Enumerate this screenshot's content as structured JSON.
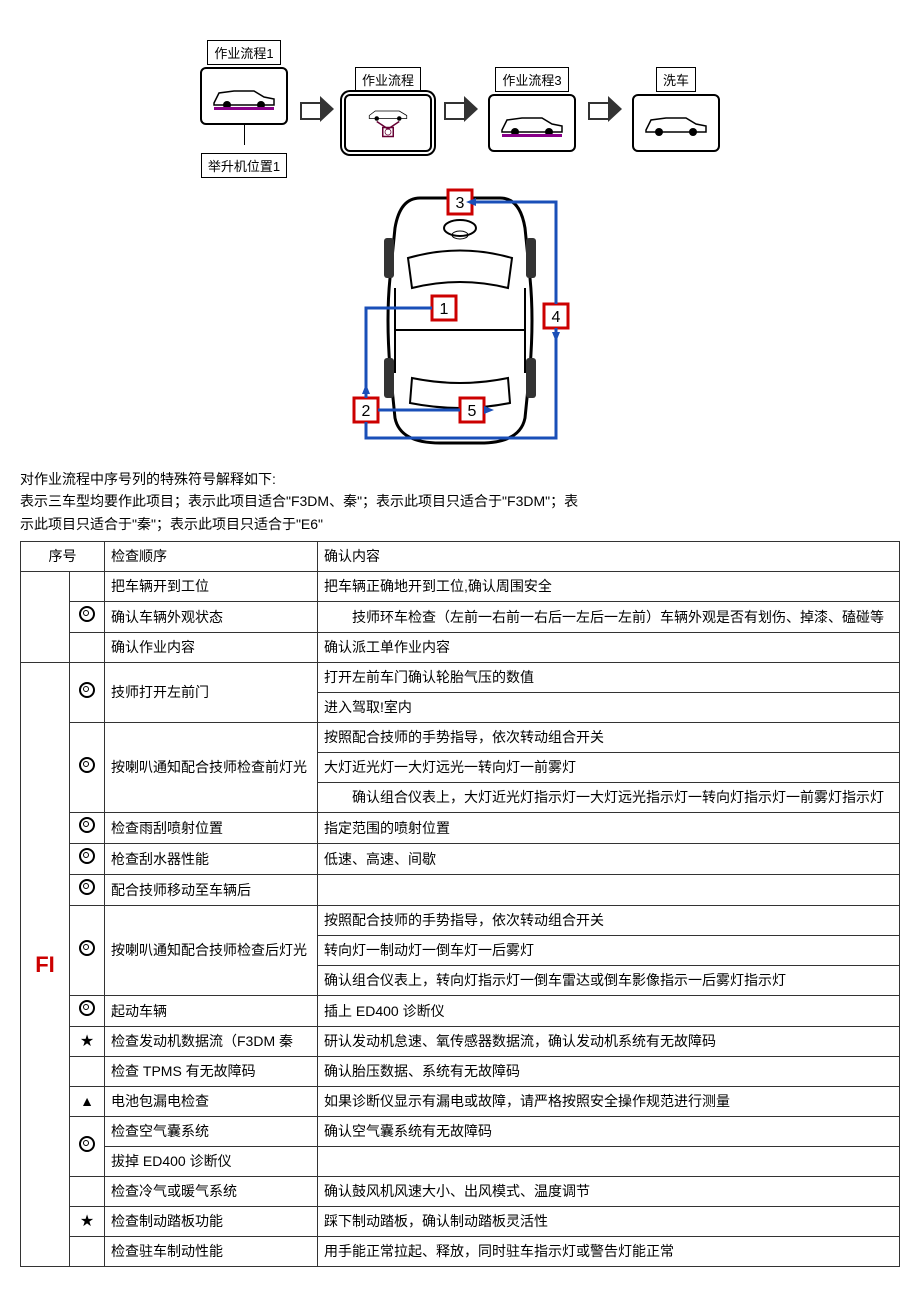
{
  "flow": {
    "stages": [
      "作业流程1",
      "作业流程",
      "作业流程3",
      "洗车"
    ],
    "lift_label": "举升机位置1"
  },
  "car_nums": [
    "1",
    "2",
    "3",
    "4",
    "5"
  ],
  "intro_lines": [
    "对作业流程中序号列的特殊符号解释如下:",
    "表示三车型均要作此项目；表示此项目适合\"F3DM、秦\"；表示此项目只适合于\"F3DM\"；表",
    "示此项目只适合于\"秦\"；表示此项目只适合于\"E6\""
  ],
  "header": {
    "seq": "序号",
    "check": "检查顺序",
    "confirm": "确认内容"
  },
  "groups": [
    {
      "seq": "",
      "rows": [
        {
          "sym": "",
          "check": "把车辆开到工位",
          "confirm": "把车辆正确地开到工位,确认周围安全"
        },
        {
          "sym": "circ",
          "check": "确认车辆外观状态",
          "confirm": "　　技师环车检查（左前一右前一右后一左后一左前）车辆外观是否有划伤、掉漆、磕碰等"
        },
        {
          "sym": "",
          "check": "确认作业内容",
          "confirm": "确认派工单作业内容"
        }
      ]
    },
    {
      "seq": "FI",
      "rows": [
        {
          "sym": "circ",
          "check": "技师打开左前门",
          "check_rowspan": 2,
          "confirm": "打开左前车门确认轮胎气压的数值"
        },
        {
          "confirm": "进入驾取!室内"
        },
        {
          "sym": "circ",
          "check": "按喇叭通知配合技师检查前灯光",
          "check_rowspan": 3,
          "confirm": "按照配合技师的手势指导，依次转动组合开关"
        },
        {
          "confirm": "大灯近光灯一大灯远光一转向灯一前雾灯"
        },
        {
          "confirm": "　　确认组合仪表上，大灯近光灯指示灯一大灯远光指示灯一转向灯指示灯一前雾灯指示灯"
        },
        {
          "sym": "circ",
          "check": "检查雨刮喷射位置",
          "confirm": "指定范围的喷射位置"
        },
        {
          "sym": "circ",
          "check": "枪查刮水器性能",
          "confirm": "低速、高速、间歇"
        },
        {
          "sym": "circ",
          "check": "配合技师移动至车辆后",
          "confirm": ""
        },
        {
          "sym": "circ",
          "check": "按喇叭通知配合技师检查后灯光",
          "check_rowspan": 3,
          "confirm": "按照配合技师的手势指导，依次转动组合开关"
        },
        {
          "confirm": "转向灯一制动灯一倒车灯一后雾灯"
        },
        {
          "confirm": "确认组合仪表上，转向灯指示灯一倒车雷达或倒车影像指示一后雾灯指示灯"
        },
        {
          "sym": "circ",
          "check": "起动车辆",
          "confirm": "插上 ED400 诊断仪"
        },
        {
          "sym": "star",
          "check": "检查发动机数据流（F3DM 秦",
          "confirm": "研认发动机怠速、氧传感器数据流，确认发动机系统有无故障码"
        },
        {
          "sym": "",
          "check": "检查 TPMS 有无故障码",
          "confirm": "确认胎压数据、系统有无故障码"
        },
        {
          "sym": "tri",
          "check": "电池包漏电检查",
          "confirm": "如果诊断仪显示有漏电或故障，请严格按照安全操作规范进行测量"
        },
        {
          "sym": "circ",
          "check": "检查空气囊系统",
          "check_rowspan": 2,
          "confirm": "确认空气囊系统有无故障码"
        },
        {
          "check_sub": "拔掉 ED400 诊断仪",
          "confirm": ""
        },
        {
          "sym": "",
          "check": "检查冷气或暖气系统",
          "confirm": "确认鼓风机风速大小、出风模式、温度调节"
        },
        {
          "sym": "star",
          "check": "检查制动踏板功能",
          "confirm": "踩下制动踏板，确认制动踏板灵活性"
        },
        {
          "sym": "",
          "check": "检查驻车制动性能",
          "confirm": "用手能正常拉起、释放，同时驻车指示灯或警告灯能正常"
        }
      ]
    }
  ]
}
